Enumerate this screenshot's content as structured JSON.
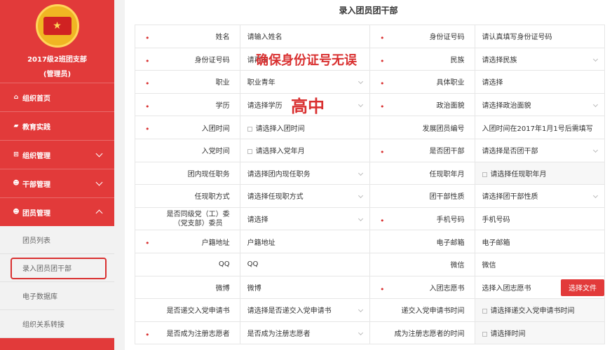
{
  "sidebar": {
    "branch": "2017级2班团支部",
    "role": "(管理员)",
    "menu": [
      {
        "icon": "home-icon",
        "glyph": "⌂",
        "label": "组织首页"
      },
      {
        "icon": "folder-icon",
        "glyph": "▰",
        "label": "教育实践"
      },
      {
        "icon": "org-icon",
        "glyph": "⊞",
        "label": "组织管理"
      },
      {
        "icon": "users-icon",
        "glyph": "☻",
        "label": "干部管理"
      },
      {
        "icon": "users-icon",
        "glyph": "☻",
        "label": "团员管理"
      }
    ],
    "submenu": [
      "团员列表",
      "录入团员团干部",
      "电子数据库",
      "组织关系转接"
    ]
  },
  "main": {
    "title": "录入团员团干部",
    "upload_label": "选择文件",
    "rows": [
      [
        {
          "label": "姓名",
          "req": true,
          "val": "请输入姓名",
          "type": "text"
        },
        {
          "label": "身份证号码",
          "req": true,
          "val": "请认真填写身份证号码",
          "type": "text"
        }
      ],
      [
        {
          "label": "身份证号码",
          "req": true,
          "val": "请再次",
          "type": "text"
        },
        {
          "label": "民族",
          "req": true,
          "val": "请选择民族",
          "type": "select"
        }
      ],
      [
        {
          "label": "职业",
          "req": true,
          "val": "职业青年",
          "type": "select"
        },
        {
          "label": "具体职业",
          "req": true,
          "val": "请选择",
          "type": "text"
        }
      ],
      [
        {
          "label": "学历",
          "req": true,
          "val": "请选择学历",
          "type": "select"
        },
        {
          "label": "政治面貌",
          "req": true,
          "val": "请选择政治面貌",
          "type": "select"
        }
      ],
      [
        {
          "label": "入团时间",
          "req": true,
          "val": "请选择入团时间",
          "type": "date"
        },
        {
          "label": "发展团员编号",
          "req": false,
          "val": "入团时间在2017年1月1号后需填写",
          "type": "text"
        }
      ],
      [
        {
          "label": "入党时间",
          "req": false,
          "val": "请选择入党年月",
          "type": "date"
        },
        {
          "label": "是否团干部",
          "req": true,
          "val": "请选择是否团干部",
          "type": "select"
        }
      ],
      [
        {
          "label": "团内现任职务",
          "req": false,
          "val": "请选择团内现任职务",
          "type": "select"
        },
        {
          "label": "任现职年月",
          "req": false,
          "val": "请选择任现职年月",
          "type": "date"
        }
      ],
      [
        {
          "label": "任现职方式",
          "req": false,
          "val": "请选择任现职方式",
          "type": "select"
        },
        {
          "label": "团干部性质",
          "req": false,
          "val": "请选择团干部性质",
          "type": "select"
        }
      ],
      [
        {
          "label": "是否同级党（工）委",
          "label2": "（党支部）委员",
          "req": false,
          "val": "请选择",
          "type": "select"
        },
        {
          "label": "手机号码",
          "req": true,
          "val": "手机号码",
          "type": "text"
        }
      ],
      [
        {
          "label": "户籍地址",
          "req": true,
          "val": "户籍地址",
          "type": "text"
        },
        {
          "label": "电子邮箱",
          "req": false,
          "val": "电子邮箱",
          "type": "text"
        }
      ],
      [
        {
          "label": "QQ",
          "req": false,
          "val": "QQ",
          "type": "text"
        },
        {
          "label": "微信",
          "req": false,
          "val": "微信",
          "type": "text"
        }
      ],
      [
        {
          "label": "微博",
          "req": false,
          "val": "微博",
          "type": "text"
        },
        {
          "label": "入团志愿书",
          "req": true,
          "val": "选择入团志愿书",
          "type": "file"
        }
      ],
      [
        {
          "label": "是否递交入党申请书",
          "req": false,
          "val": "请选择是否递交入党申请书",
          "type": "select"
        },
        {
          "label": "递交入党申请书时间",
          "req": false,
          "val": "请选择递交入党申请书时间",
          "type": "date"
        }
      ],
      [
        {
          "label": "是否成为注册志愿者",
          "req": true,
          "val": "是否成为注册志愿者",
          "type": "select"
        },
        {
          "label": "成为注册志愿者的时间",
          "req": false,
          "val": "请选择时间",
          "type": "date"
        }
      ]
    ]
  },
  "annotations": {
    "note1": "确保身份证号无误",
    "note2": "高中"
  }
}
